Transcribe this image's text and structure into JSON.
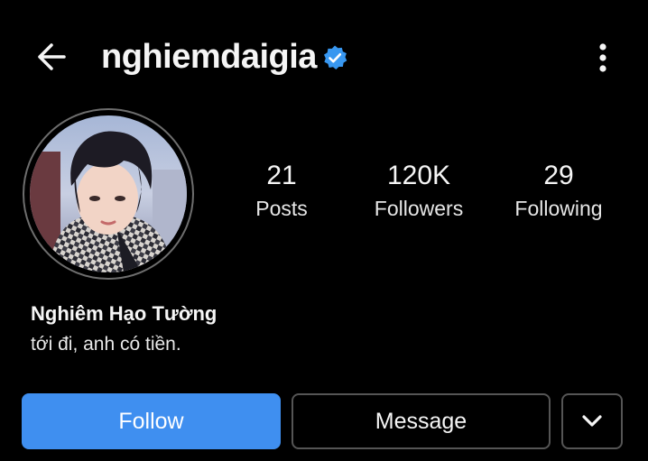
{
  "header": {
    "username": "nghiemdaigia",
    "verified": true,
    "back_icon": "arrow-left-icon",
    "more_icon": "kebab-vertical-icon"
  },
  "profile": {
    "display_name": "Nghiêm Hạo Tường",
    "bio": "tới đi, anh có tiền."
  },
  "stats": {
    "posts": {
      "value": "21",
      "label": "Posts"
    },
    "followers": {
      "value": "120K",
      "label": "Followers"
    },
    "following": {
      "value": "29",
      "label": "Following"
    }
  },
  "actions": {
    "follow_label": "Follow",
    "message_label": "Message",
    "dropdown_icon": "chevron-down-icon"
  },
  "colors": {
    "background": "#000000",
    "accent": "#3f8ff0",
    "verified_badge": "#3897f0",
    "text": "#f5f5f5"
  }
}
